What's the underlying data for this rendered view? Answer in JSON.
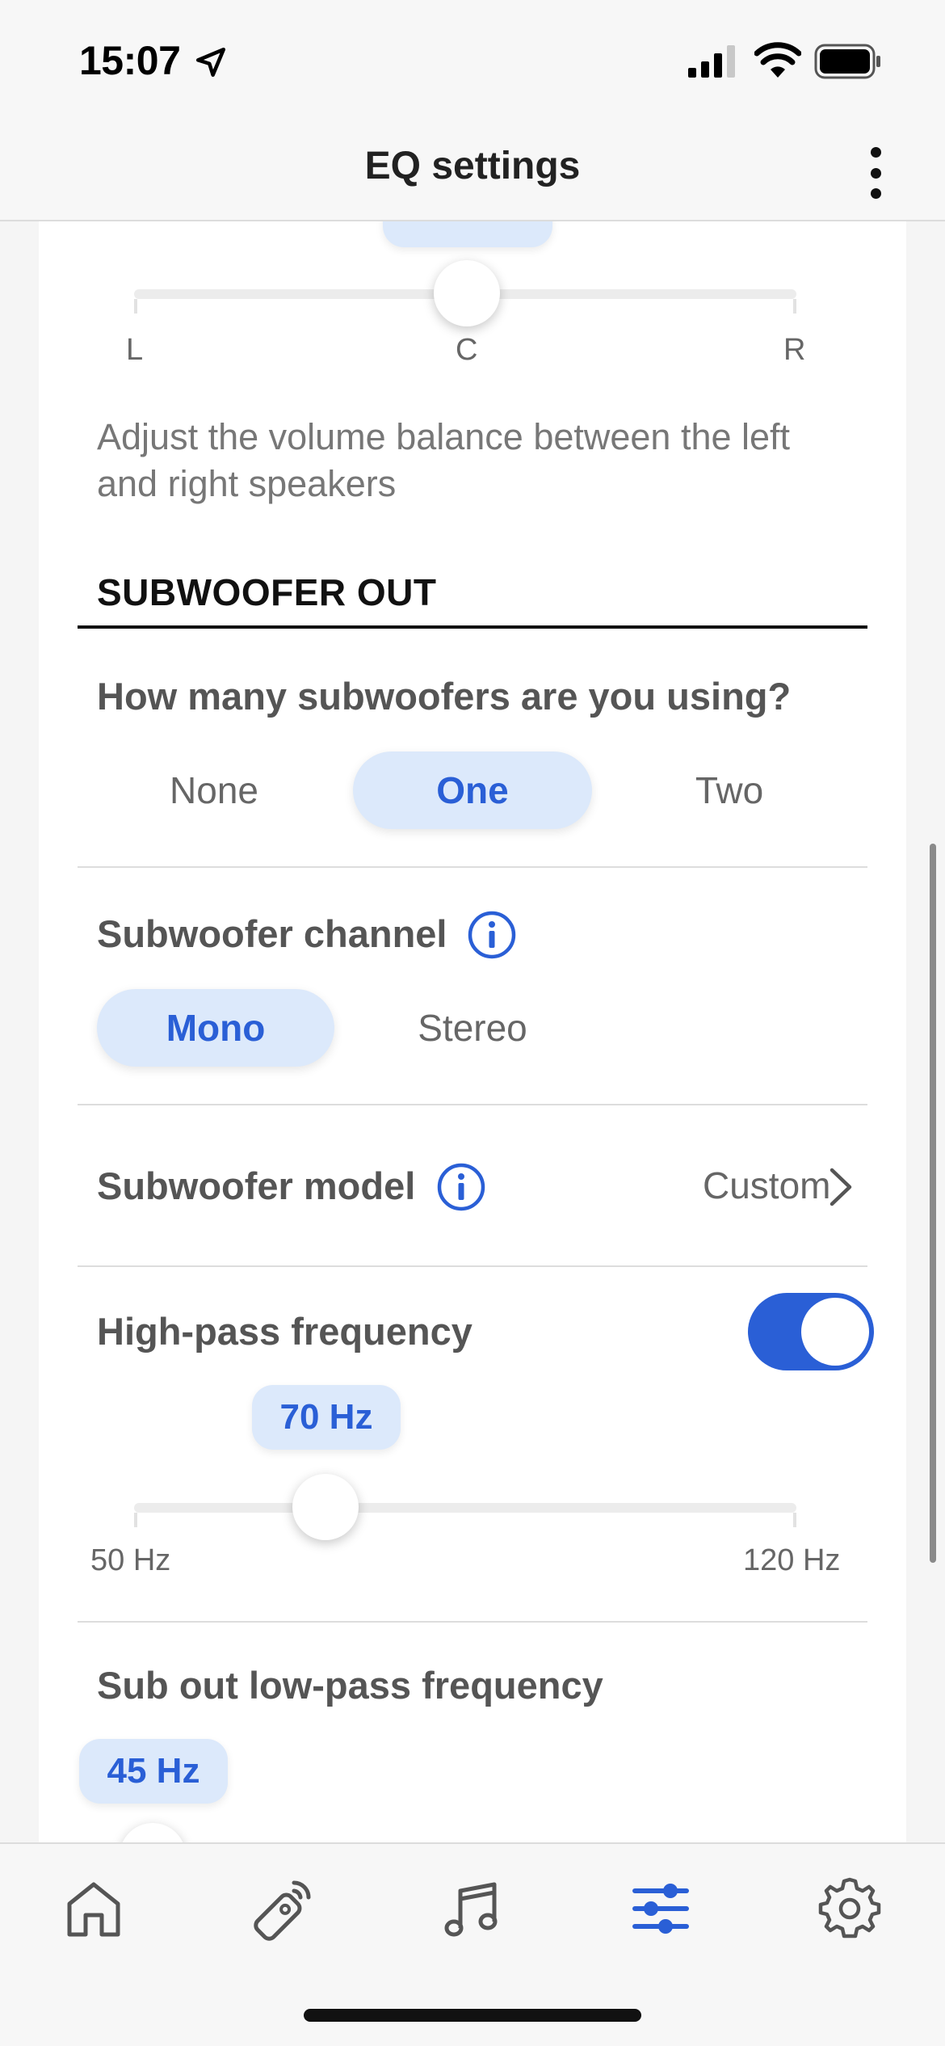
{
  "status_bar": {
    "time": "15:07"
  },
  "header": {
    "title": "EQ settings"
  },
  "balance": {
    "tick_left": "L",
    "tick_center": "C",
    "tick_right": "R",
    "description": "Adjust the volume balance between the left and right speakers"
  },
  "subwoofer_out": {
    "section_title": "SUBWOOFER OUT",
    "count_question": "How many subwoofers are you using?",
    "count_options": [
      "None",
      "One",
      "Two"
    ],
    "count_selected": "One",
    "channel_label": "Subwoofer channel",
    "channel_options": [
      "Mono",
      "Stereo"
    ],
    "channel_selected": "Mono",
    "model_label": "Subwoofer model",
    "model_value": "Custom",
    "high_pass_label": "High-pass frequency",
    "high_pass_enabled": true,
    "high_pass_value": "70 Hz",
    "high_pass_min": "50 Hz",
    "high_pass_max": "120 Hz",
    "low_pass_label": "Sub out low-pass frequency",
    "low_pass_value": "45 Hz"
  },
  "tabs": {
    "items": [
      "home-icon",
      "remote-icon",
      "music-icon",
      "equalizer-icon",
      "settings-gear-icon"
    ],
    "active": "equalizer-icon"
  },
  "colors": {
    "accent": "#2a5fd6",
    "selected_bg": "#dce9fb"
  }
}
